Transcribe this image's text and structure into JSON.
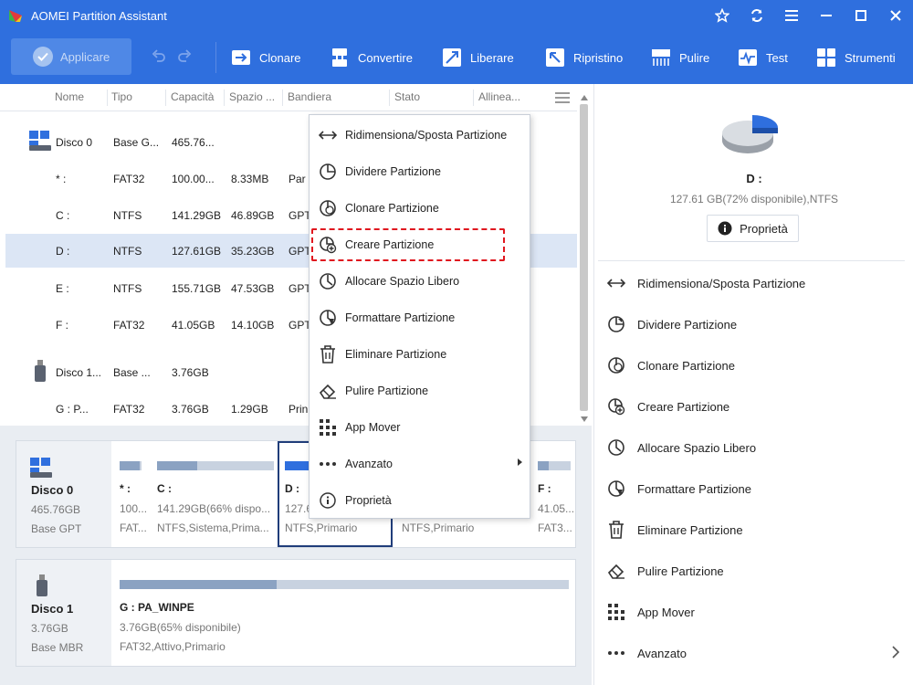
{
  "window": {
    "title": "AOMEI Partition Assistant"
  },
  "toolbar": {
    "apply_label": "Applicare",
    "items": [
      {
        "label": "Clonare",
        "icon": "clone-icon"
      },
      {
        "label": "Convertire",
        "icon": "convert-icon"
      },
      {
        "label": "Liberare",
        "icon": "free-up-icon"
      },
      {
        "label": "Ripristino",
        "icon": "recovery-icon"
      },
      {
        "label": "Pulire",
        "icon": "wipe-icon"
      },
      {
        "label": "Test",
        "icon": "test-icon"
      },
      {
        "label": "Strumenti",
        "icon": "tools-icon"
      }
    ]
  },
  "table": {
    "columns": [
      "Nome",
      "Tipo",
      "Capacità",
      "Spazio ...",
      "Bandiera",
      "Stato",
      "Allinea..."
    ],
    "rows": [
      {
        "name": "Disco 0",
        "type": "Base G...",
        "cap": "465.76...",
        "free": "",
        "flag": "",
        "kind": "disk"
      },
      {
        "name": "* :",
        "type": "FAT32",
        "cap": "100.00...",
        "free": "8.33MB",
        "flag": "Par",
        "kind": "part"
      },
      {
        "name": "C :",
        "type": "NTFS",
        "cap": "141.29GB",
        "free": "46.89GB",
        "flag": "GPT",
        "kind": "part"
      },
      {
        "name": "D :",
        "type": "NTFS",
        "cap": "127.61GB",
        "free": "35.23GB",
        "flag": "GPT",
        "kind": "part"
      },
      {
        "name": "E :",
        "type": "NTFS",
        "cap": "155.71GB",
        "free": "47.53GB",
        "flag": "GPT",
        "kind": "part"
      },
      {
        "name": "F :",
        "type": "FAT32",
        "cap": "41.05GB",
        "free": "14.10GB",
        "flag": "GPT",
        "kind": "part"
      },
      {
        "name": "Disco 1...",
        "type": "Base ...",
        "cap": "3.76GB",
        "free": "",
        "flag": "",
        "kind": "usb"
      },
      {
        "name": "G : P...",
        "type": "FAT32",
        "cap": "3.76GB",
        "free": "1.29GB",
        "flag": "Prin",
        "kind": "part"
      }
    ]
  },
  "diskmap": {
    "disk0": {
      "name": "Disco 0",
      "size": "465.76GB",
      "type": "Base GPT",
      "parts": [
        {
          "label": "* :",
          "line1": "100....",
          "line2": "FAT...",
          "fill": 0.9
        },
        {
          "label": "C :",
          "line1": "141.29GB(66% dispo...",
          "line2": "NTFS,Sistema,Prima...",
          "fill": 0.34
        },
        {
          "label": "D :",
          "line1": "127.6",
          "line2": "NTFS,Primario",
          "fill": 0.28
        },
        {
          "label": "",
          "line1": "",
          "line2": "NTFS,Primario",
          "fill": 0.3
        },
        {
          "label": "F :",
          "line1": "41.05...",
          "line2": "FAT3...",
          "fill": 0.34
        }
      ]
    },
    "disk1": {
      "name": "Disco 1",
      "size": "3.76GB",
      "type": "Base MBR",
      "part": {
        "label": "G : PA_WINPE",
        "line1": "3.76GB(65% disponibile)",
        "line2": "FAT32,Attivo,Primario",
        "fill": 0.35
      }
    }
  },
  "context_menu": {
    "items": [
      {
        "label": "Ridimensiona/Sposta Partizione",
        "icon": "resize-icon"
      },
      {
        "label": "Dividere Partizione",
        "icon": "split-icon"
      },
      {
        "label": "Clonare Partizione",
        "icon": "clone-partition-icon"
      },
      {
        "label": "Creare Partizione",
        "icon": "create-partition-icon"
      },
      {
        "label": "Allocare Spazio Libero",
        "icon": "allocate-icon"
      },
      {
        "label": "Formattare Partizione",
        "icon": "format-icon"
      },
      {
        "label": "Eliminare Partizione",
        "icon": "trash-icon"
      },
      {
        "label": "Pulire Partizione",
        "icon": "eraser-icon"
      },
      {
        "label": "App Mover",
        "icon": "app-mover-icon"
      },
      {
        "label": "Avanzato",
        "icon": "more-icon"
      },
      {
        "label": "Proprietà",
        "icon": "info-icon"
      }
    ]
  },
  "right_panel": {
    "disk_label": "D :",
    "disk_info": "127.61 GB(72% disponibile),NTFS",
    "used_fraction": 0.28,
    "prop_button": "Proprietà",
    "ops": [
      {
        "label": "Ridimensiona/Sposta Partizione",
        "icon": "resize-icon"
      },
      {
        "label": "Dividere Partizione",
        "icon": "split-icon"
      },
      {
        "label": "Clonare Partizione",
        "icon": "clone-partition-icon"
      },
      {
        "label": "Creare Partizione",
        "icon": "create-partition-icon"
      },
      {
        "label": "Allocare Spazio Libero",
        "icon": "allocate-icon"
      },
      {
        "label": "Formattare Partizione",
        "icon": "format-icon"
      },
      {
        "label": "Eliminare Partizione",
        "icon": "trash-icon"
      },
      {
        "label": "Pulire Partizione",
        "icon": "eraser-icon"
      },
      {
        "label": "App Mover",
        "icon": "app-mover-icon"
      },
      {
        "label": "Avanzato",
        "icon": "more-icon"
      }
    ]
  },
  "colors": {
    "accent": "#2f6fde",
    "selection": "#dce6f5",
    "highlight_dashed": "#e0171f"
  }
}
